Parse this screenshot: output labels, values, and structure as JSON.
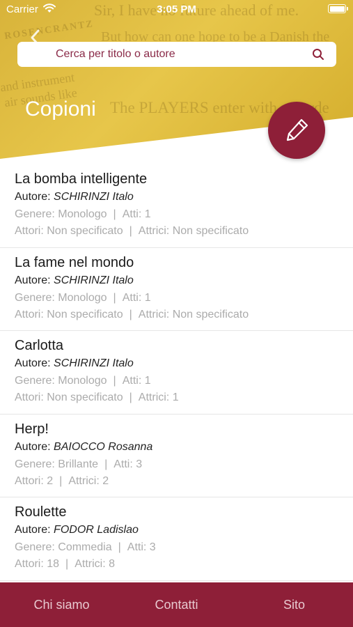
{
  "status_bar": {
    "carrier": "Carrier",
    "time": "3:05 PM"
  },
  "search": {
    "placeholder": "Cerca per titolo o autore"
  },
  "header": {
    "title": "Copioni",
    "background_words": [
      "Sir, I have no future ahead of me.",
      "ROSENCRANTZ",
      "But how can one hope to be a Danish the",
      "and instrument",
      "air sounds like",
      "The PLAYERS enter with recorde"
    ]
  },
  "labels": {
    "author": "Autore:",
    "genre": "Genere:",
    "acts": "Atti:",
    "actors": "Attori:",
    "actresses": "Attrici:"
  },
  "items": [
    {
      "title": "La bomba intelligente",
      "author": "SCHIRINZI Italo",
      "genre": "Monologo",
      "acts": "1",
      "actors": "Non specificato",
      "actresses": "Non specificato"
    },
    {
      "title": "La fame nel mondo",
      "author": "SCHIRINZI Italo",
      "genre": "Monologo",
      "acts": "1",
      "actors": "Non specificato",
      "actresses": "Non specificato"
    },
    {
      "title": "Carlotta",
      "author": "SCHIRINZI Italo",
      "genre": "Monologo",
      "acts": "1",
      "actors": "Non specificato",
      "actresses": "1"
    },
    {
      "title": "Herp!",
      "author": "BAIOCCO Rosanna",
      "genre": "Brillante",
      "acts": "3",
      "actors": "2",
      "actresses": "2"
    },
    {
      "title": "Roulette",
      "author": "FODOR Ladislao",
      "genre": "Commedia",
      "acts": "3",
      "actors": "18",
      "actresses": "8"
    }
  ],
  "bottom_nav": {
    "about": "Chi siamo",
    "contacts": "Contatti",
    "site": "Sito"
  },
  "colors": {
    "accent": "#8e1f38",
    "header_gold": "#dfbd42",
    "meta_gray": "#ababab"
  }
}
